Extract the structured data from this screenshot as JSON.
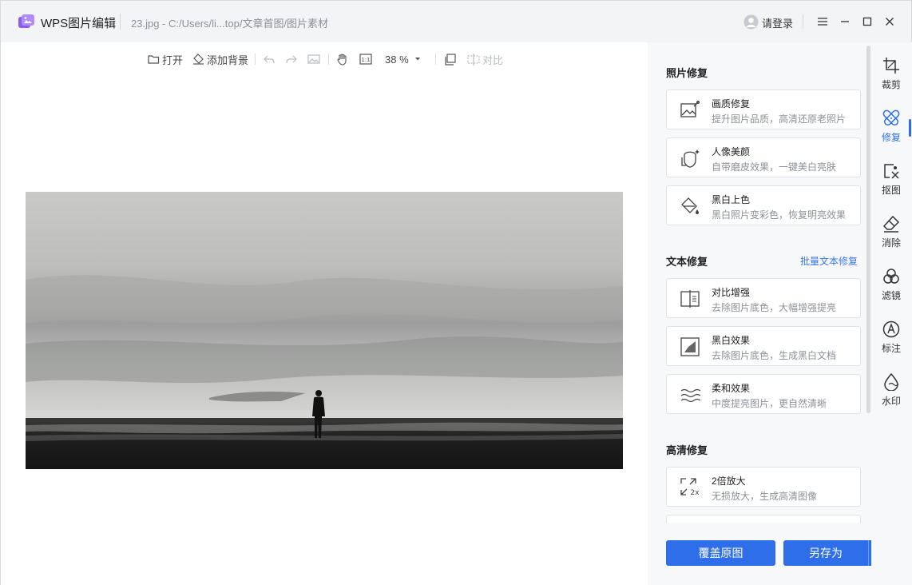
{
  "titlebar": {
    "app_name": "WPS图片编辑",
    "file_path": "23.jpg - C:/Users/li...top/文章首图/图片素材",
    "login_label": "请登录"
  },
  "toolbar": {
    "open_label": "打开",
    "add_bg_label": "添加背景",
    "zoom_value": "38 %",
    "compare_label": "对比"
  },
  "panel": {
    "photo_repair": {
      "title": "照片修复",
      "cards": [
        {
          "title": "画质修复",
          "desc": "提升图片品质，高清还原老照片",
          "icon": "image-quality-icon"
        },
        {
          "title": "人像美颜",
          "desc": "自带磨皮效果，一键美白亮肤",
          "icon": "portrait-beauty-icon"
        },
        {
          "title": "黑白上色",
          "desc": "黑白照片变彩色，恢复明亮效果",
          "icon": "colorize-icon"
        }
      ]
    },
    "text_repair": {
      "title": "文本修复",
      "link": "批量文本修复",
      "cards": [
        {
          "title": "对比增强",
          "desc": "去除图片底色，大幅增强提亮",
          "icon": "contrast-enhance-icon"
        },
        {
          "title": "黑白效果",
          "desc": "去除图片底色，生成黑白文档",
          "icon": "bw-effect-icon"
        },
        {
          "title": "柔和效果",
          "desc": "中度提亮图片，更自然清晰",
          "icon": "soft-effect-icon"
        }
      ]
    },
    "hd_repair": {
      "title": "高清修复",
      "cards": [
        {
          "title": "2倍放大",
          "desc": "无损放大，生成高清图像",
          "icon": "upscale-2x-icon"
        }
      ]
    },
    "overwrite_label": "覆盖原图",
    "save_as_label": "另存为"
  },
  "rail": [
    {
      "label": "裁剪",
      "icon": "crop-icon"
    },
    {
      "label": "修复",
      "icon": "repair-icon",
      "active": true
    },
    {
      "label": "抠图",
      "icon": "cutout-icon"
    },
    {
      "label": "消除",
      "icon": "eraser-icon"
    },
    {
      "label": "滤镜",
      "icon": "filter-icon"
    },
    {
      "label": "标注",
      "icon": "annotate-icon"
    },
    {
      "label": "水印",
      "icon": "watermark-icon"
    }
  ],
  "colors": {
    "accent": "#2e6ee8",
    "panel_bg": "#f7f8fa"
  }
}
